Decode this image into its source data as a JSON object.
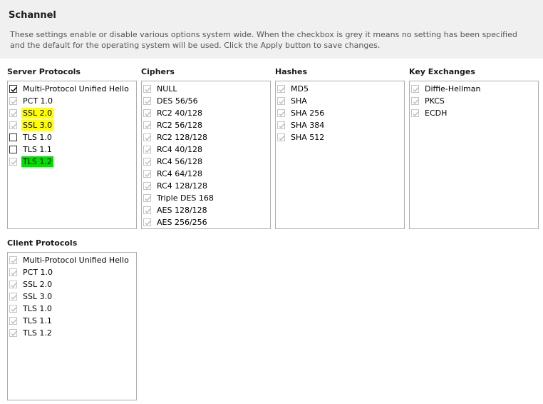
{
  "header": {
    "title": "Schannel",
    "description": "These settings enable or disable various options system wide. When the checkbox is grey it means no setting has been specified and the default for the operating system will be used. Click the Apply button to save changes."
  },
  "colors": {
    "highlight_yellow": "#ffff00",
    "highlight_green": "#00e000",
    "indeterminate_check": "#bdbdbd",
    "checked_check": "#000000"
  },
  "server_protocols": {
    "title": "Server Protocols",
    "items": [
      {
        "label": "Multi-Protocol Unified Hello",
        "state": "checked",
        "highlight": ""
      },
      {
        "label": "PCT 1.0",
        "state": "indeterminate",
        "highlight": ""
      },
      {
        "label": "SSL 2.0",
        "state": "indeterminate",
        "highlight": "yellow"
      },
      {
        "label": "SSL 3.0",
        "state": "indeterminate",
        "highlight": "yellow"
      },
      {
        "label": "TLS 1.0",
        "state": "unchecked",
        "highlight": ""
      },
      {
        "label": "TLS 1.1",
        "state": "unchecked",
        "highlight": ""
      },
      {
        "label": "TLS 1.2",
        "state": "indeterminate",
        "highlight": "green"
      }
    ]
  },
  "ciphers": {
    "title": "Ciphers",
    "items": [
      {
        "label": "NULL",
        "state": "indeterminate"
      },
      {
        "label": "DES 56/56",
        "state": "indeterminate"
      },
      {
        "label": "RC2 40/128",
        "state": "indeterminate"
      },
      {
        "label": "RC2 56/128",
        "state": "indeterminate"
      },
      {
        "label": "RC2 128/128",
        "state": "indeterminate"
      },
      {
        "label": "RC4 40/128",
        "state": "indeterminate"
      },
      {
        "label": "RC4 56/128",
        "state": "indeterminate"
      },
      {
        "label": "RC4 64/128",
        "state": "indeterminate"
      },
      {
        "label": "RC4 128/128",
        "state": "indeterminate"
      },
      {
        "label": "Triple DES 168",
        "state": "indeterminate"
      },
      {
        "label": "AES 128/128",
        "state": "indeterminate"
      },
      {
        "label": "AES 256/256",
        "state": "indeterminate"
      }
    ]
  },
  "hashes": {
    "title": "Hashes",
    "items": [
      {
        "label": "MD5",
        "state": "indeterminate"
      },
      {
        "label": "SHA",
        "state": "indeterminate"
      },
      {
        "label": "SHA 256",
        "state": "indeterminate"
      },
      {
        "label": "SHA 384",
        "state": "indeterminate"
      },
      {
        "label": "SHA 512",
        "state": "indeterminate"
      }
    ]
  },
  "key_exchanges": {
    "title": "Key Exchanges",
    "items": [
      {
        "label": "Diffie-Hellman",
        "state": "indeterminate"
      },
      {
        "label": "PKCS",
        "state": "indeterminate"
      },
      {
        "label": "ECDH",
        "state": "indeterminate"
      }
    ]
  },
  "client_protocols": {
    "title": "Client Protocols",
    "items": [
      {
        "label": "Multi-Protocol Unified Hello",
        "state": "indeterminate"
      },
      {
        "label": "PCT 1.0",
        "state": "indeterminate"
      },
      {
        "label": "SSL 2.0",
        "state": "indeterminate"
      },
      {
        "label": "SSL 3.0",
        "state": "indeterminate"
      },
      {
        "label": "TLS 1.0",
        "state": "indeterminate"
      },
      {
        "label": "TLS 1.1",
        "state": "indeterminate"
      },
      {
        "label": "TLS 1.2",
        "state": "indeterminate"
      }
    ]
  }
}
